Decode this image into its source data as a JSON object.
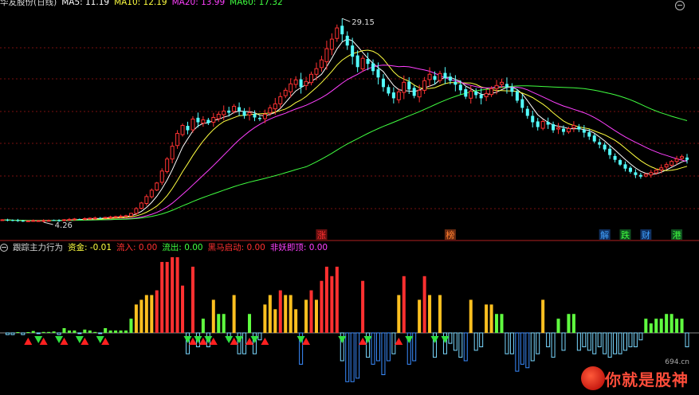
{
  "header": {
    "title": "华友股份(日线)",
    "ma": [
      {
        "label": "MA5: 11.19",
        "color": "#ffffff"
      },
      {
        "label": "MA10: 12.19",
        "color": "#ffff40"
      },
      {
        "label": "MA20: 13.99",
        "color": "#ff40ff"
      },
      {
        "label": "MA60: 17.32",
        "color": "#40ff40"
      }
    ]
  },
  "indicator": {
    "name": "跟踪主力行为",
    "items": [
      {
        "label": "资金: -0.01",
        "color": "#ffff40"
      },
      {
        "label": "流入: 0.00",
        "color": "#ff3030"
      },
      {
        "label": "流出: 0.00",
        "color": "#40ff40"
      },
      {
        "label": "黑马启动: 0.00",
        "color": "#ff3030"
      },
      {
        "label": "非妖即顶: 0.00",
        "color": "#ff40ff"
      }
    ]
  },
  "colors": {
    "up": "#ff3232",
    "down": "#54ffff",
    "ma5": "#ffffff",
    "ma10": "#ffff40",
    "ma20": "#ff40ff",
    "ma60": "#40ff40",
    "grid": "#7a1010",
    "bg": "#000000"
  },
  "chart_data": {
    "type": "candlestick",
    "title": "华友股份(日线)",
    "price_annotations": {
      "high": "29.15",
      "low": "4.26"
    },
    "price_range": [
      3.5,
      30.5
    ],
    "event_labels": [
      {
        "text": "涨",
        "index": 62,
        "color": "#ff3030",
        "bg": "#6a1010"
      },
      {
        "text": "榜",
        "index": 87,
        "color": "#ff8030",
        "bg": "#6a2a10"
      },
      {
        "text": "解",
        "index": 117,
        "color": "#40a0ff",
        "bg": "#103060"
      },
      {
        "text": "跌",
        "index": 121,
        "color": "#40ff40",
        "bg": "#105020"
      },
      {
        "text": "财",
        "index": 125,
        "color": "#40a0ff",
        "bg": "#103060"
      },
      {
        "text": "港",
        "index": 131,
        "color": "#40ff40",
        "bg": "#105020"
      }
    ],
    "close": [
      4.4,
      4.35,
      4.3,
      4.3,
      4.25,
      4.26,
      4.3,
      4.28,
      4.3,
      4.32,
      4.35,
      4.3,
      4.4,
      4.45,
      4.5,
      4.48,
      4.55,
      4.6,
      4.62,
      4.6,
      4.7,
      4.75,
      4.8,
      4.85,
      4.9,
      5.2,
      5.8,
      6.5,
      7.3,
      8.1,
      9.0,
      10.5,
      12.0,
      13.6,
      15.2,
      16.2,
      15.6,
      17.0,
      16.6,
      16.9,
      16.5,
      17.2,
      17.6,
      18.0,
      17.8,
      18.6,
      18.0,
      17.4,
      17.8,
      17.2,
      17.0,
      17.6,
      18.4,
      18.9,
      19.8,
      20.6,
      21.4,
      21.9,
      21.0,
      21.7,
      22.6,
      23.3,
      24.4,
      25.8,
      27.0,
      28.4,
      27.6,
      26.2,
      24.8,
      23.5,
      24.6,
      23.9,
      23.0,
      22.2,
      21.0,
      20.2,
      19.6,
      20.4,
      21.6,
      20.7,
      19.9,
      20.6,
      21.8,
      22.6,
      21.9,
      22.7,
      22.1,
      21.8,
      21.3,
      20.6,
      19.8,
      20.5,
      20.0,
      19.6,
      20.2,
      20.8,
      21.2,
      21.6,
      21.0,
      20.4,
      19.3,
      18.4,
      17.4,
      16.6,
      16.0,
      16.7,
      16.3,
      15.6,
      15.9,
      15.4,
      15.8,
      16.2,
      15.7,
      15.3,
      14.8,
      14.2,
      13.8,
      13.2,
      12.5,
      11.9,
      11.3,
      10.8,
      10.4,
      10.0,
      9.8,
      10.1,
      10.3,
      10.6,
      10.9,
      11.3,
      11.7,
      12.0,
      12.3,
      11.9
    ]
  },
  "indicator_chart": {
    "type": "bar",
    "baseline_label": "0",
    "signals": {
      "up_triangles": 14,
      "down_triangles": 16
    }
  },
  "watermark": {
    "text": "你就是股神",
    "site": "694.cn"
  }
}
